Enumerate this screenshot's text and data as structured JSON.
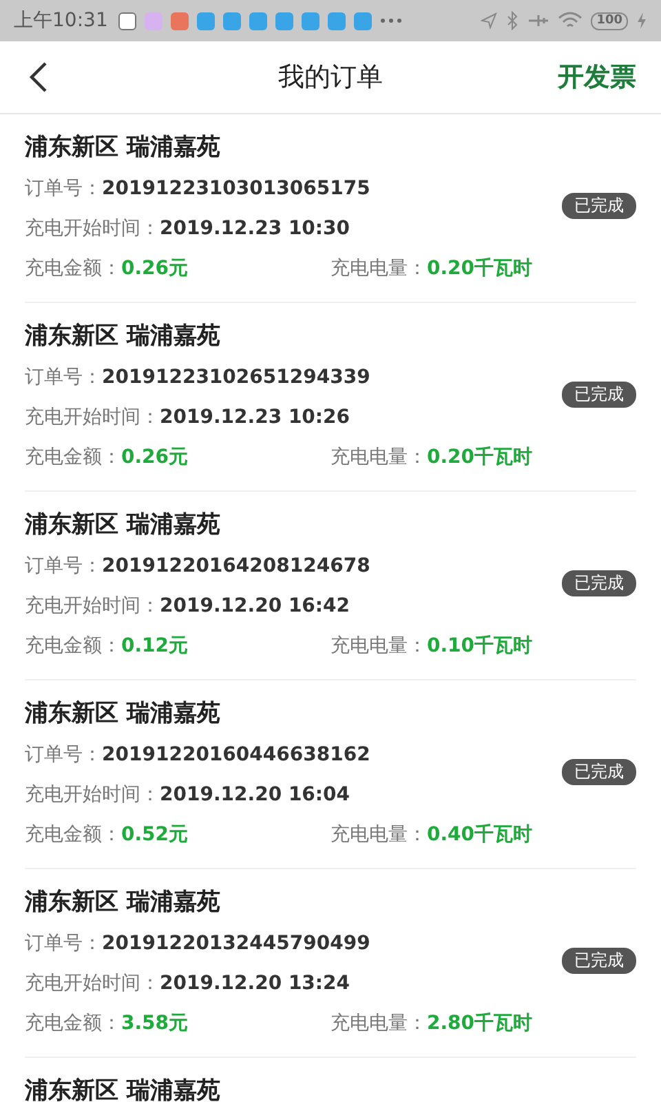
{
  "status_bar": {
    "time": "上午10:31",
    "battery": "100"
  },
  "header": {
    "title": "我的订单",
    "action": "开发票"
  },
  "orders": [
    {
      "station": "浦东新区 瑞浦嘉苑",
      "order_label": "订单号：",
      "order_no": "20191223103013065175",
      "time_label": "充电开始时间：",
      "start_time": "2019.12.23 10:30",
      "amount_label": "充电金额：",
      "amount": "0.26元",
      "energy_label": "充电电量：",
      "energy": "0.20千瓦时",
      "status": "已完成"
    },
    {
      "station": "浦东新区 瑞浦嘉苑",
      "order_label": "订单号：",
      "order_no": "20191223102651294339",
      "time_label": "充电开始时间：",
      "start_time": "2019.12.23 10:26",
      "amount_label": "充电金额：",
      "amount": "0.26元",
      "energy_label": "充电电量：",
      "energy": "0.20千瓦时",
      "status": "已完成"
    },
    {
      "station": "浦东新区 瑞浦嘉苑",
      "order_label": "订单号：",
      "order_no": "20191220164208124678",
      "time_label": "充电开始时间：",
      "start_time": "2019.12.20 16:42",
      "amount_label": "充电金额：",
      "amount": "0.12元",
      "energy_label": "充电电量：",
      "energy": "0.10千瓦时",
      "status": "已完成"
    },
    {
      "station": "浦东新区 瑞浦嘉苑",
      "order_label": "订单号：",
      "order_no": "20191220160446638162",
      "time_label": "充电开始时间：",
      "start_time": "2019.12.20 16:04",
      "amount_label": "充电金额：",
      "amount": "0.52元",
      "energy_label": "充电电量：",
      "energy": "0.40千瓦时",
      "status": "已完成"
    },
    {
      "station": "浦东新区 瑞浦嘉苑",
      "order_label": "订单号：",
      "order_no": "20191220132445790499",
      "time_label": "充电开始时间：",
      "start_time": "2019.12.20 13:24",
      "amount_label": "充电金额：",
      "amount": "3.58元",
      "energy_label": "充电电量：",
      "energy": "2.80千瓦时",
      "status": "已完成"
    },
    {
      "station": "浦东新区 瑞浦嘉苑"
    }
  ]
}
